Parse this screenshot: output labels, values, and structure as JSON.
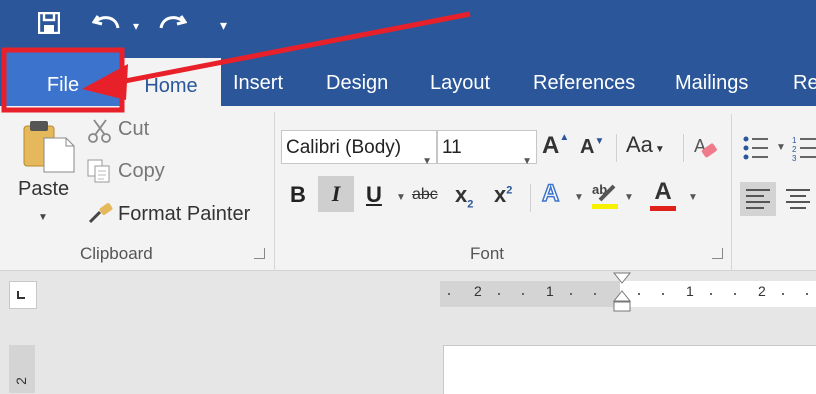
{
  "quick_access": {
    "save_icon": "save-icon",
    "undo_icon": "undo-icon",
    "redo_icon": "redo-icon",
    "customize_icon": "customize-qat-icon"
  },
  "tabs": [
    {
      "label": "File"
    },
    {
      "label": "Home"
    },
    {
      "label": "Insert"
    },
    {
      "label": "Design"
    },
    {
      "label": "Layout"
    },
    {
      "label": "References"
    },
    {
      "label": "Mailings"
    },
    {
      "label": "Re"
    }
  ],
  "clipboard": {
    "paste": "Paste",
    "cut": "Cut",
    "copy": "Copy",
    "format_painter": "Format Painter",
    "group_label": "Clipboard"
  },
  "font": {
    "font_name": "Calibri (Body)",
    "font_size": "11",
    "change_case": "Aa",
    "strikethrough": "abc",
    "subscript": "x",
    "subscript_mark": "2",
    "superscript": "x",
    "superscript_mark": "2",
    "group_label": "Font"
  },
  "ruler": {
    "labels": [
      "2",
      "1",
      "1",
      "2"
    ],
    "vertical_label": "2"
  },
  "colors": {
    "title_bar": "#2b579a",
    "file_tab": "#3c74cd",
    "highlight_box": "#e8202a",
    "font_color_underline": "#e0201b"
  }
}
